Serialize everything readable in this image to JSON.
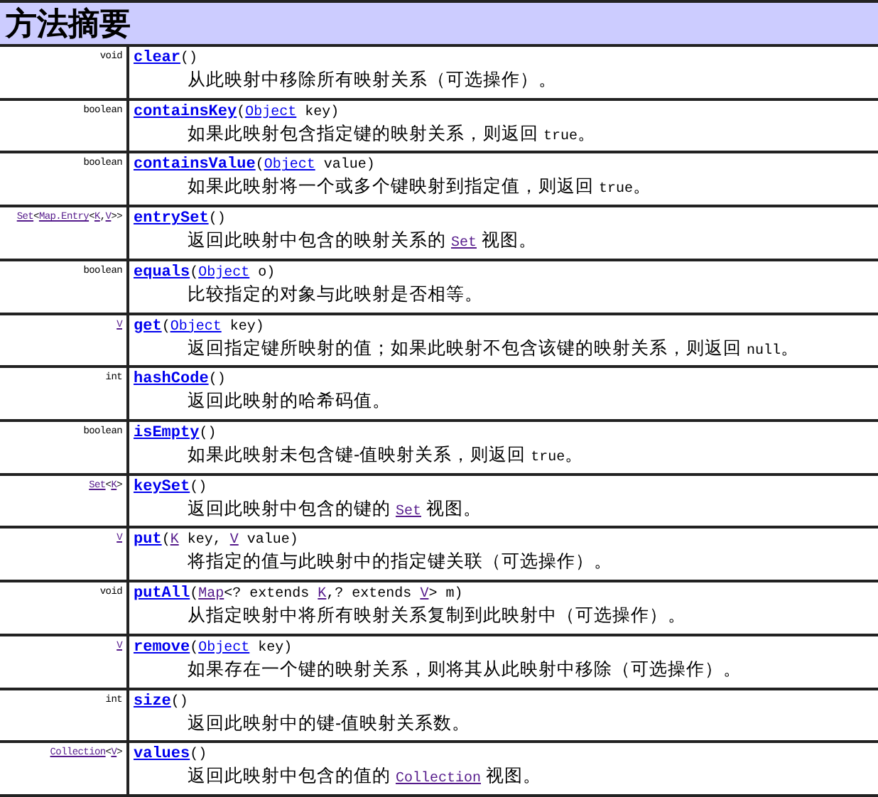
{
  "title": "方法摘要",
  "rows": [
    {
      "return_type": [
        {
          "kind": "plain",
          "text": "void"
        }
      ],
      "name": "clear",
      "params": [],
      "description": [
        {
          "kind": "plain",
          "text": "从此映射中移除所有映射关系（可选操作）。"
        }
      ]
    },
    {
      "return_type": [
        {
          "kind": "plain",
          "text": "boolean"
        }
      ],
      "name": "containsKey",
      "params": [
        {
          "kind": "link",
          "text": "Object"
        },
        {
          "kind": "plain",
          "text": " key"
        }
      ],
      "description": [
        {
          "kind": "plain",
          "text": "如果此映射包含指定键的映射关系，则返回 "
        },
        {
          "kind": "code",
          "text": "true"
        },
        {
          "kind": "plain",
          "text": "。"
        }
      ]
    },
    {
      "return_type": [
        {
          "kind": "plain",
          "text": "boolean"
        }
      ],
      "name": "containsValue",
      "params": [
        {
          "kind": "link",
          "text": "Object"
        },
        {
          "kind": "plain",
          "text": " value"
        }
      ],
      "description": [
        {
          "kind": "plain",
          "text": "如果此映射将一个或多个键映射到指定值，则返回 "
        },
        {
          "kind": "code",
          "text": "true"
        },
        {
          "kind": "plain",
          "text": "。"
        }
      ]
    },
    {
      "return_type": [
        {
          "kind": "visited",
          "text": "Set"
        },
        {
          "kind": "plain",
          "text": "<"
        },
        {
          "kind": "visited",
          "text": "Map.Entry"
        },
        {
          "kind": "plain",
          "text": "<"
        },
        {
          "kind": "visited",
          "text": "K"
        },
        {
          "kind": "plain",
          "text": ","
        },
        {
          "kind": "visited",
          "text": "V"
        },
        {
          "kind": "plain",
          "text": ">>"
        }
      ],
      "name": "entrySet",
      "params": [],
      "description": [
        {
          "kind": "plain",
          "text": "返回此映射中包含的映射关系的 "
        },
        {
          "kind": "visited",
          "text": "Set"
        },
        {
          "kind": "plain",
          "text": " 视图。"
        }
      ]
    },
    {
      "return_type": [
        {
          "kind": "plain",
          "text": "boolean"
        }
      ],
      "name": "equals",
      "params": [
        {
          "kind": "link",
          "text": "Object"
        },
        {
          "kind": "plain",
          "text": " o"
        }
      ],
      "description": [
        {
          "kind": "plain",
          "text": "比较指定的对象与此映射是否相等。"
        }
      ]
    },
    {
      "return_type": [
        {
          "kind": "visited",
          "text": "V"
        }
      ],
      "name": "get",
      "params": [
        {
          "kind": "link",
          "text": "Object"
        },
        {
          "kind": "plain",
          "text": " key"
        }
      ],
      "description": [
        {
          "kind": "plain",
          "text": "返回指定键所映射的值；如果此映射不包含该键的映射关系，则返回 "
        },
        {
          "kind": "code",
          "text": "null"
        },
        {
          "kind": "plain",
          "text": "。"
        }
      ]
    },
    {
      "return_type": [
        {
          "kind": "plain",
          "text": "int"
        }
      ],
      "name": "hashCode",
      "params": [],
      "description": [
        {
          "kind": "plain",
          "text": "返回此映射的哈希码值。"
        }
      ]
    },
    {
      "return_type": [
        {
          "kind": "plain",
          "text": "boolean"
        }
      ],
      "name": "isEmpty",
      "params": [],
      "description": [
        {
          "kind": "plain",
          "text": "如果此映射未包含键-值映射关系，则返回 "
        },
        {
          "kind": "code",
          "text": "true"
        },
        {
          "kind": "plain",
          "text": "。"
        }
      ]
    },
    {
      "return_type": [
        {
          "kind": "visited",
          "text": "Set"
        },
        {
          "kind": "plain",
          "text": "<"
        },
        {
          "kind": "visited",
          "text": "K"
        },
        {
          "kind": "plain",
          "text": ">"
        }
      ],
      "name": "keySet",
      "params": [],
      "description": [
        {
          "kind": "plain",
          "text": "返回此映射中包含的键的 "
        },
        {
          "kind": "visited",
          "text": "Set"
        },
        {
          "kind": "plain",
          "text": " 视图。"
        }
      ]
    },
    {
      "return_type": [
        {
          "kind": "visited",
          "text": "V"
        }
      ],
      "name": "put",
      "params": [
        {
          "kind": "visited",
          "text": "K"
        },
        {
          "kind": "plain",
          "text": " key, "
        },
        {
          "kind": "visited",
          "text": "V"
        },
        {
          "kind": "plain",
          "text": " value"
        }
      ],
      "description": [
        {
          "kind": "plain",
          "text": "将指定的值与此映射中的指定键关联（可选操作）。"
        }
      ]
    },
    {
      "return_type": [
        {
          "kind": "plain",
          "text": "void"
        }
      ],
      "name": "putAll",
      "params": [
        {
          "kind": "visited",
          "text": "Map"
        },
        {
          "kind": "plain",
          "text": "<? extends "
        },
        {
          "kind": "visited",
          "text": "K"
        },
        {
          "kind": "plain",
          "text": ",? extends "
        },
        {
          "kind": "visited",
          "text": "V"
        },
        {
          "kind": "plain",
          "text": "> m"
        }
      ],
      "description": [
        {
          "kind": "plain",
          "text": "从指定映射中将所有映射关系复制到此映射中（可选操作）。"
        }
      ]
    },
    {
      "return_type": [
        {
          "kind": "visited",
          "text": "V"
        }
      ],
      "name": "remove",
      "params": [
        {
          "kind": "link",
          "text": "Object"
        },
        {
          "kind": "plain",
          "text": " key"
        }
      ],
      "description": [
        {
          "kind": "plain",
          "text": "如果存在一个键的映射关系，则将其从此映射中移除（可选操作）。"
        }
      ]
    },
    {
      "return_type": [
        {
          "kind": "plain",
          "text": "int"
        }
      ],
      "name": "size",
      "params": [],
      "description": [
        {
          "kind": "plain",
          "text": "返回此映射中的键-值映射关系数。"
        }
      ]
    },
    {
      "return_type": [
        {
          "kind": "visited",
          "text": "Collection"
        },
        {
          "kind": "plain",
          "text": "<"
        },
        {
          "kind": "visited",
          "text": "V"
        },
        {
          "kind": "plain",
          "text": ">"
        }
      ],
      "name": "values",
      "params": [],
      "description": [
        {
          "kind": "plain",
          "text": "返回此映射中包含的值的 "
        },
        {
          "kind": "visited",
          "text": "Collection"
        },
        {
          "kind": "plain",
          "text": " 视图。"
        }
      ]
    }
  ],
  "paren_open": "(",
  "paren_close": ")"
}
